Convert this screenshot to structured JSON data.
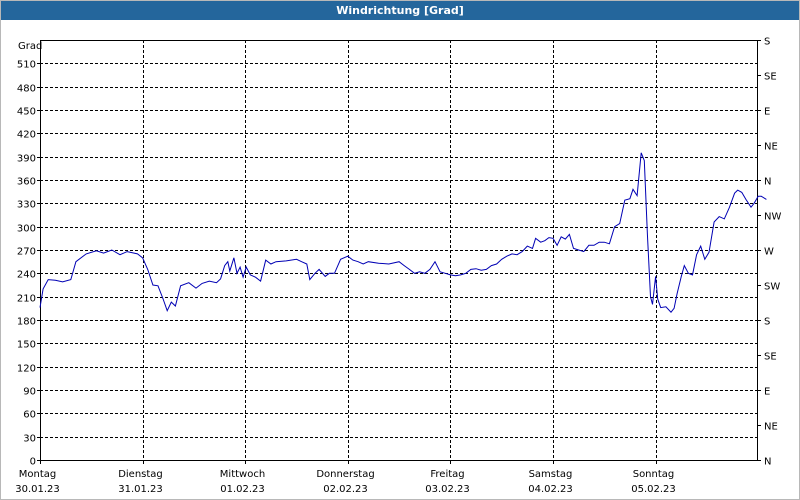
{
  "window": {
    "title": "Windrichtung [Grad]"
  },
  "chart_data": {
    "type": "line",
    "title": "Windrichtung [Grad]",
    "ylabel": "Grad",
    "ylim": [
      0,
      540
    ],
    "yticks": [
      0,
      30,
      60,
      90,
      120,
      150,
      180,
      210,
      240,
      270,
      300,
      330,
      360,
      390,
      420,
      450,
      480,
      510
    ],
    "y2ticks": [
      {
        "value": 0,
        "label": "N"
      },
      {
        "value": 45,
        "label": "NE"
      },
      {
        "value": 90,
        "label": "E"
      },
      {
        "value": 135,
        "label": "SE"
      },
      {
        "value": 180,
        "label": "S"
      },
      {
        "value": 225,
        "label": "SW"
      },
      {
        "value": 270,
        "label": "W"
      },
      {
        "value": 315,
        "label": "NW"
      },
      {
        "value": 360,
        "label": "N"
      },
      {
        "value": 405,
        "label": "NE"
      },
      {
        "value": 450,
        "label": "E"
      },
      {
        "value": 495,
        "label": "SE"
      },
      {
        "value": 540,
        "label": "S"
      }
    ],
    "xlim": [
      0,
      7
    ],
    "xticks": [
      {
        "day": "Montag",
        "date": "30.01.23"
      },
      {
        "day": "Dienstag",
        "date": "31.01.23"
      },
      {
        "day": "Mittwoch",
        "date": "01.02.23"
      },
      {
        "day": "Donnerstag",
        "date": "02.02.23"
      },
      {
        "day": "Freitag",
        "date": "03.02.23"
      },
      {
        "day": "Samstag",
        "date": "04.02.23"
      },
      {
        "day": "Sonntag",
        "date": "05.02.23"
      }
    ],
    "grid": true,
    "line_color": "#0000b4",
    "series": [
      {
        "name": "",
        "points": [
          [
            0.0,
            196
          ],
          [
            0.03,
            220
          ],
          [
            0.08,
            232
          ],
          [
            0.15,
            231
          ],
          [
            0.22,
            229
          ],
          [
            0.3,
            232
          ],
          [
            0.35,
            255
          ],
          [
            0.45,
            265
          ],
          [
            0.55,
            269
          ],
          [
            0.62,
            266
          ],
          [
            0.7,
            270
          ],
          [
            0.78,
            264
          ],
          [
            0.85,
            268
          ],
          [
            0.95,
            265
          ],
          [
            1.0,
            260
          ],
          [
            1.05,
            245
          ],
          [
            1.1,
            225
          ],
          [
            1.15,
            224
          ],
          [
            1.2,
            207
          ],
          [
            1.24,
            192
          ],
          [
            1.28,
            203
          ],
          [
            1.32,
            198
          ],
          [
            1.37,
            224
          ],
          [
            1.45,
            228
          ],
          [
            1.52,
            221
          ],
          [
            1.58,
            227
          ],
          [
            1.65,
            230
          ],
          [
            1.72,
            228
          ],
          [
            1.76,
            233
          ],
          [
            1.8,
            250
          ],
          [
            1.83,
            255
          ],
          [
            1.85,
            243
          ],
          [
            1.89,
            260
          ],
          [
            1.92,
            240
          ],
          [
            1.95,
            248
          ],
          [
            1.98,
            235
          ],
          [
            2.01,
            248
          ],
          [
            2.05,
            238
          ],
          [
            2.1,
            235
          ],
          [
            2.15,
            230
          ],
          [
            2.2,
            257
          ],
          [
            2.25,
            252
          ],
          [
            2.3,
            255
          ],
          [
            2.4,
            256
          ],
          [
            2.5,
            258
          ],
          [
            2.55,
            255
          ],
          [
            2.6,
            252
          ],
          [
            2.63,
            232
          ],
          [
            2.68,
            240
          ],
          [
            2.72,
            245
          ],
          [
            2.78,
            236
          ],
          [
            2.82,
            240
          ],
          [
            2.87,
            240
          ],
          [
            2.93,
            258
          ],
          [
            3.0,
            262
          ],
          [
            3.05,
            257
          ],
          [
            3.1,
            255
          ],
          [
            3.15,
            252
          ],
          [
            3.2,
            255
          ],
          [
            3.3,
            253
          ],
          [
            3.4,
            252
          ],
          [
            3.5,
            255
          ],
          [
            3.55,
            250
          ],
          [
            3.6,
            245
          ],
          [
            3.65,
            240
          ],
          [
            3.7,
            242
          ],
          [
            3.75,
            240
          ],
          [
            3.8,
            245
          ],
          [
            3.85,
            255
          ],
          [
            3.9,
            242
          ],
          [
            3.95,
            240
          ],
          [
            4.0,
            238
          ],
          [
            4.05,
            237
          ],
          [
            4.1,
            238
          ],
          [
            4.15,
            240
          ],
          [
            4.2,
            245
          ],
          [
            4.25,
            246
          ],
          [
            4.3,
            244
          ],
          [
            4.35,
            245
          ],
          [
            4.4,
            250
          ],
          [
            4.45,
            252
          ],
          [
            4.5,
            258
          ],
          [
            4.55,
            262
          ],
          [
            4.6,
            265
          ],
          [
            4.65,
            264
          ],
          [
            4.7,
            268
          ],
          [
            4.75,
            275
          ],
          [
            4.8,
            272
          ],
          [
            4.83,
            285
          ],
          [
            4.88,
            280
          ],
          [
            4.92,
            282
          ],
          [
            4.96,
            286
          ],
          [
            5.0,
            285
          ],
          [
            5.04,
            276
          ],
          [
            5.08,
            287
          ],
          [
            5.12,
            284
          ],
          [
            5.16,
            290
          ],
          [
            5.2,
            272
          ],
          [
            5.25,
            270
          ],
          [
            5.3,
            268
          ],
          [
            5.35,
            276
          ],
          [
            5.4,
            276
          ],
          [
            5.45,
            280
          ],
          [
            5.5,
            280
          ],
          [
            5.55,
            278
          ],
          [
            5.6,
            300
          ],
          [
            5.65,
            304
          ],
          [
            5.7,
            334
          ],
          [
            5.75,
            336
          ],
          [
            5.78,
            348
          ],
          [
            5.82,
            340
          ],
          [
            5.86,
            395
          ],
          [
            5.89,
            385
          ],
          [
            5.92,
            290
          ],
          [
            5.95,
            210
          ],
          [
            5.97,
            200
          ],
          [
            6.0,
            236
          ],
          [
            6.02,
            207
          ],
          [
            6.05,
            196
          ],
          [
            6.1,
            197
          ],
          [
            6.15,
            190
          ],
          [
            6.18,
            195
          ],
          [
            6.21,
            214
          ],
          [
            6.25,
            236
          ],
          [
            6.28,
            250
          ],
          [
            6.32,
            240
          ],
          [
            6.36,
            238
          ],
          [
            6.4,
            264
          ],
          [
            6.44,
            275
          ],
          [
            6.48,
            258
          ],
          [
            6.52,
            267
          ],
          [
            6.57,
            306
          ],
          [
            6.62,
            313
          ],
          [
            6.67,
            310
          ],
          [
            6.72,
            325
          ],
          [
            6.77,
            343
          ],
          [
            6.8,
            347
          ],
          [
            6.84,
            344
          ],
          [
            6.88,
            335
          ],
          [
            6.93,
            325
          ],
          [
            6.96,
            330
          ],
          [
            7.0,
            339
          ],
          [
            7.03,
            339
          ],
          [
            7.08,
            335
          ]
        ]
      }
    ]
  }
}
